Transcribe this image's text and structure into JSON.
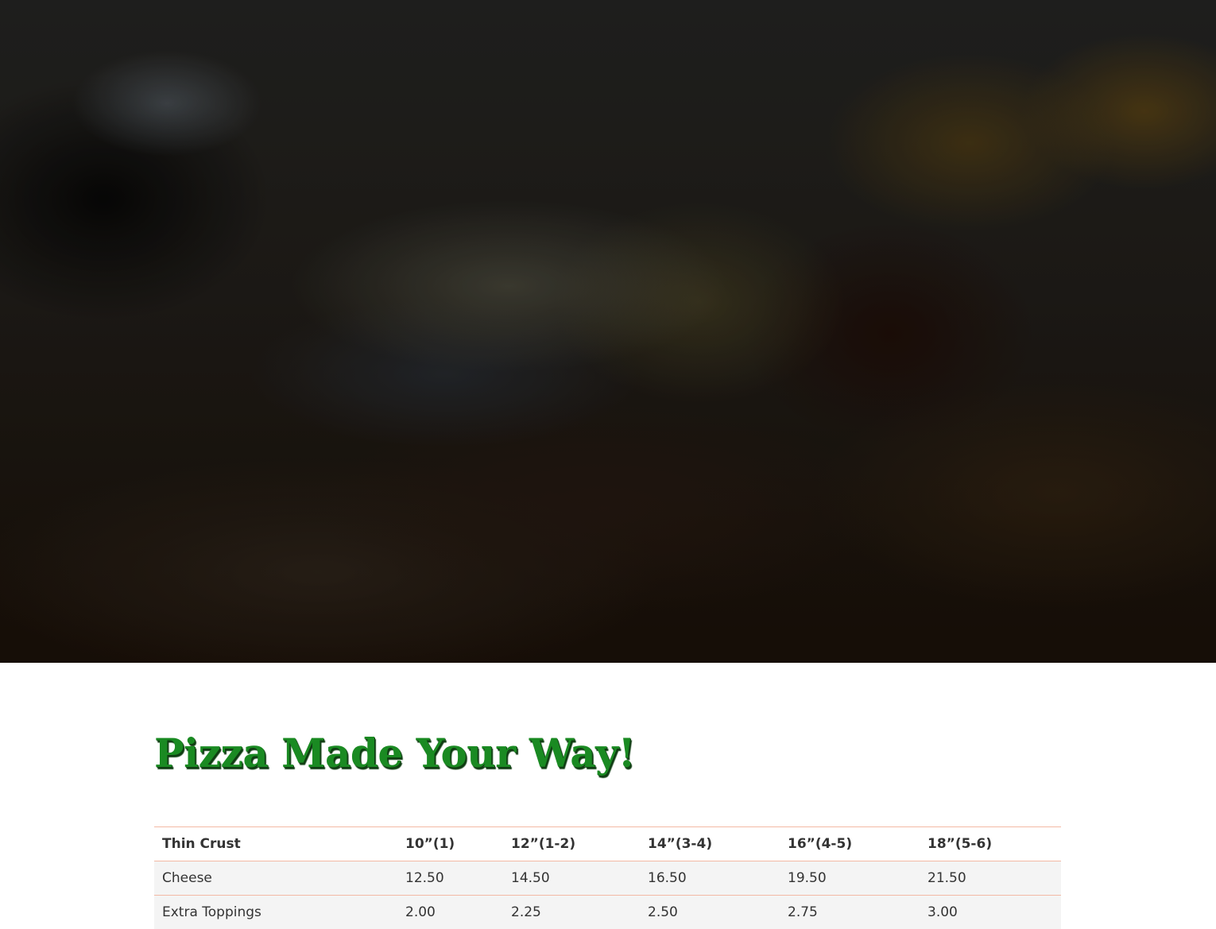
{
  "hero": {
    "image": "blurred-pizza-background"
  },
  "section": {
    "title": "Pizza Made Your Way!",
    "title_color": "#1a8a22"
  },
  "price_table": {
    "header": [
      "Thin Crust",
      "10”(1)",
      "12”(1-2)",
      "14”(3-4)",
      "16”(4-5)",
      "18”(5-6)"
    ],
    "rows": [
      [
        "Cheese",
        "12.50",
        "14.50",
        "16.50",
        "19.50",
        "21.50"
      ],
      [
        "Extra Toppings",
        "2.00",
        "2.25",
        "2.50",
        "2.75",
        "3.00"
      ]
    ],
    "border_color": "#f3b9a4",
    "row_background": "#f4f4f4"
  }
}
